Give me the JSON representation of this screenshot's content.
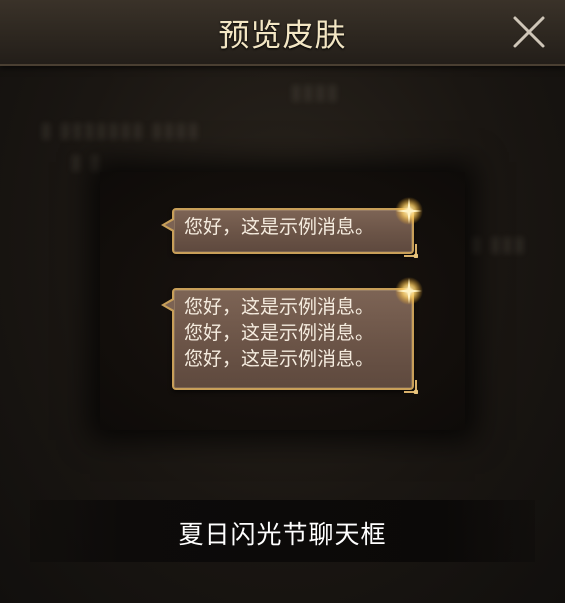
{
  "header": {
    "title": "预览皮肤",
    "close_icon": "close-icon"
  },
  "preview": {
    "bubble_short": {
      "lines": [
        "您好，这是示例消息。"
      ]
    },
    "bubble_long": {
      "lines": [
        "您好，这是示例消息。",
        "您好，这是示例消息。",
        "您好，这是示例消息。"
      ]
    }
  },
  "skin": {
    "name": "夏日闪光节聊天框"
  },
  "colors": {
    "title_text": "#f3e6c4",
    "bubble_fill": "#6b5447",
    "bubble_border": "#c89f59",
    "bubble_text": "#f5ecdf",
    "name_text": "#ffffff"
  }
}
